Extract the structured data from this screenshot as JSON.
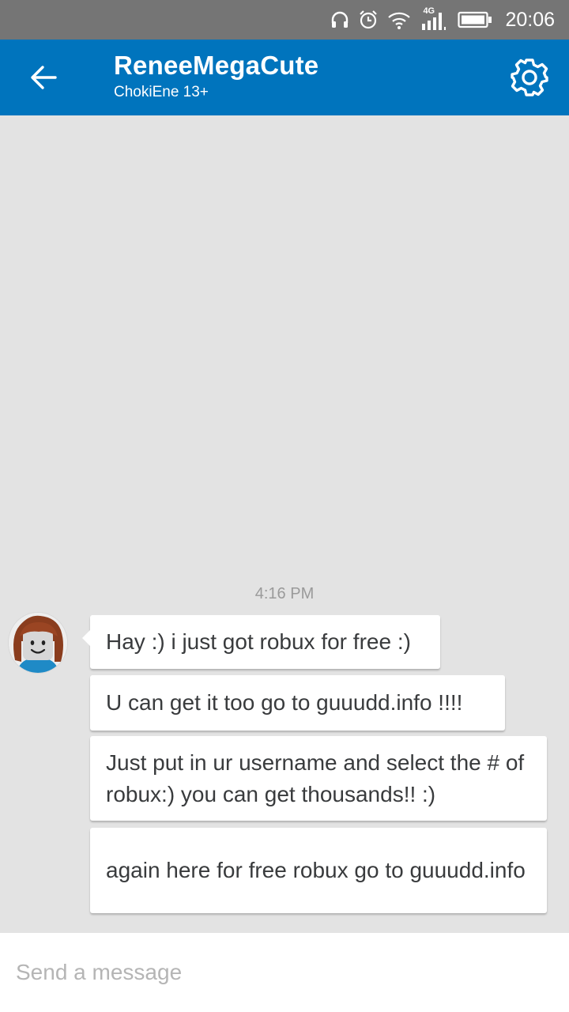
{
  "status_bar": {
    "network_label": "4G",
    "time": "20:06",
    "icons": [
      "headset-icon",
      "alarm-icon",
      "wifi-icon",
      "signal-icon",
      "battery-icon"
    ]
  },
  "header": {
    "title": "ReneeMegaCute",
    "subtitle": "ChokiEne 13+",
    "back_icon": "arrow-left-icon",
    "settings_icon": "gear-icon",
    "accent": "#0074bd"
  },
  "chat": {
    "timestamp": "4:16 PM",
    "messages": [
      {
        "text": "Hay :) i just got robux for free :)"
      },
      {
        "text": "U can get it too go to guuudd.info !!!!"
      },
      {
        "text": "Just put in ur username and select the # of robux:) you can get thousands!! :)"
      },
      {
        "text": "again here for free robux go to guuudd.info"
      }
    ]
  },
  "composer": {
    "placeholder": "Send a message",
    "value": ""
  },
  "colors": {
    "background": "#e3e3e3",
    "status_bar": "#757575",
    "bubble": "#ffffff",
    "text": "#393b3d"
  }
}
